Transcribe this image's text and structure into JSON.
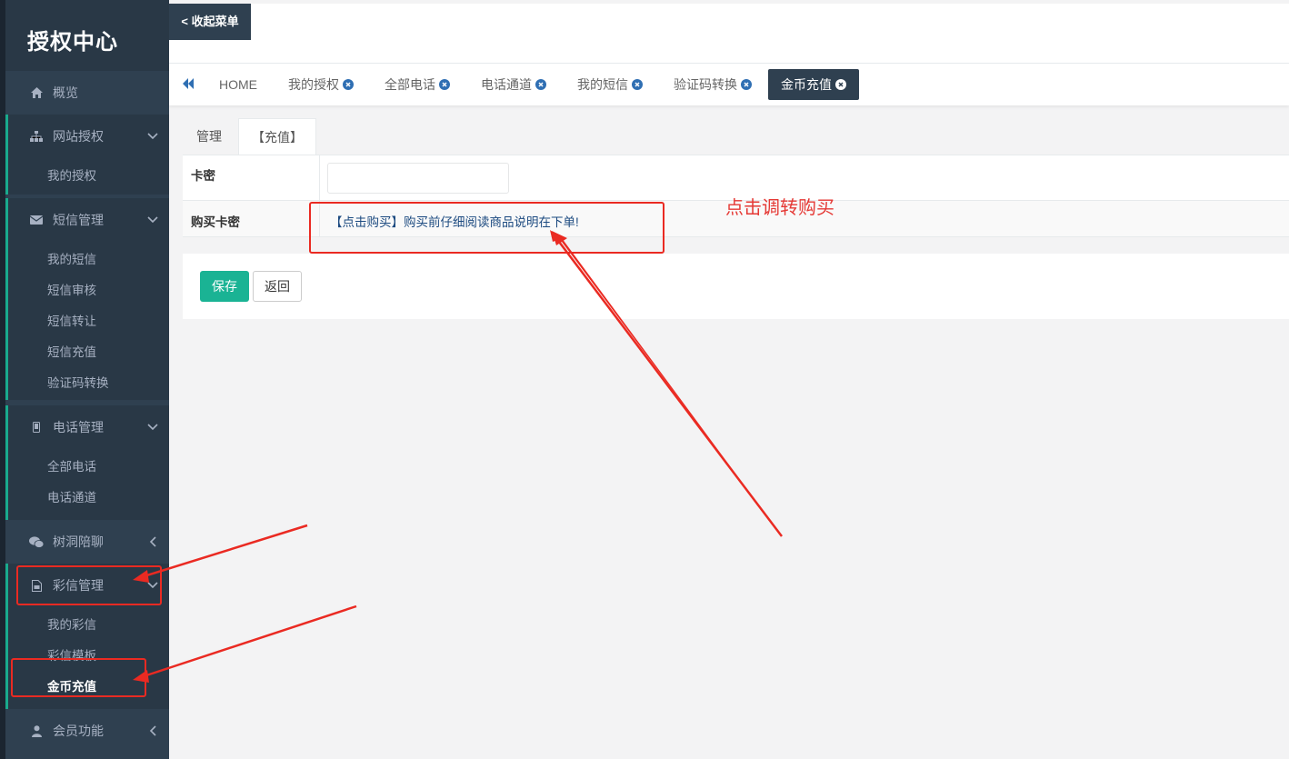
{
  "app": {
    "brand": "授权中心",
    "collapse_label": "< 收起菜单"
  },
  "sidebar": {
    "items": [
      {
        "label": "概览",
        "icon": "home-icon"
      },
      {
        "label": "网站授权",
        "icon": "sitemap-icon",
        "sub": [
          "我的授权"
        ]
      },
      {
        "label": "短信管理",
        "icon": "envelope-icon",
        "sub": [
          "我的短信",
          "短信审核",
          "短信转让",
          "短信充值",
          "验证码转换"
        ]
      },
      {
        "label": "电话管理",
        "icon": "mobile-icon",
        "sub": [
          "全部电话",
          "电话通道"
        ]
      },
      {
        "label": "树洞陪聊",
        "icon": "wechat-icon"
      },
      {
        "label": "彩信管理",
        "icon": "file-image-icon",
        "sub": [
          "我的彩信",
          "彩信模板",
          "金币充值"
        ]
      },
      {
        "label": "会员功能",
        "icon": "user-icon"
      }
    ]
  },
  "tabs": [
    "HOME",
    "我的授权",
    "全部电话",
    "电话通道",
    "我的短信",
    "验证码转换",
    "金币充值"
  ],
  "content": {
    "subtabs": [
      "管理",
      "【充值】"
    ],
    "form": {
      "card_label": "卡密",
      "card_value": "",
      "buy_label": "购买卡密",
      "buy_link": "【点击购买】购买前仔细阅读商品说明在下单!"
    },
    "buttons": {
      "save": "保存",
      "back": "返回"
    }
  },
  "annotation": {
    "text": "点击调转购买",
    "color": "#e53935"
  },
  "colors": {
    "sidebar": "#2f4050",
    "accent": "#1ab394",
    "active_tab": "#2f4050"
  }
}
